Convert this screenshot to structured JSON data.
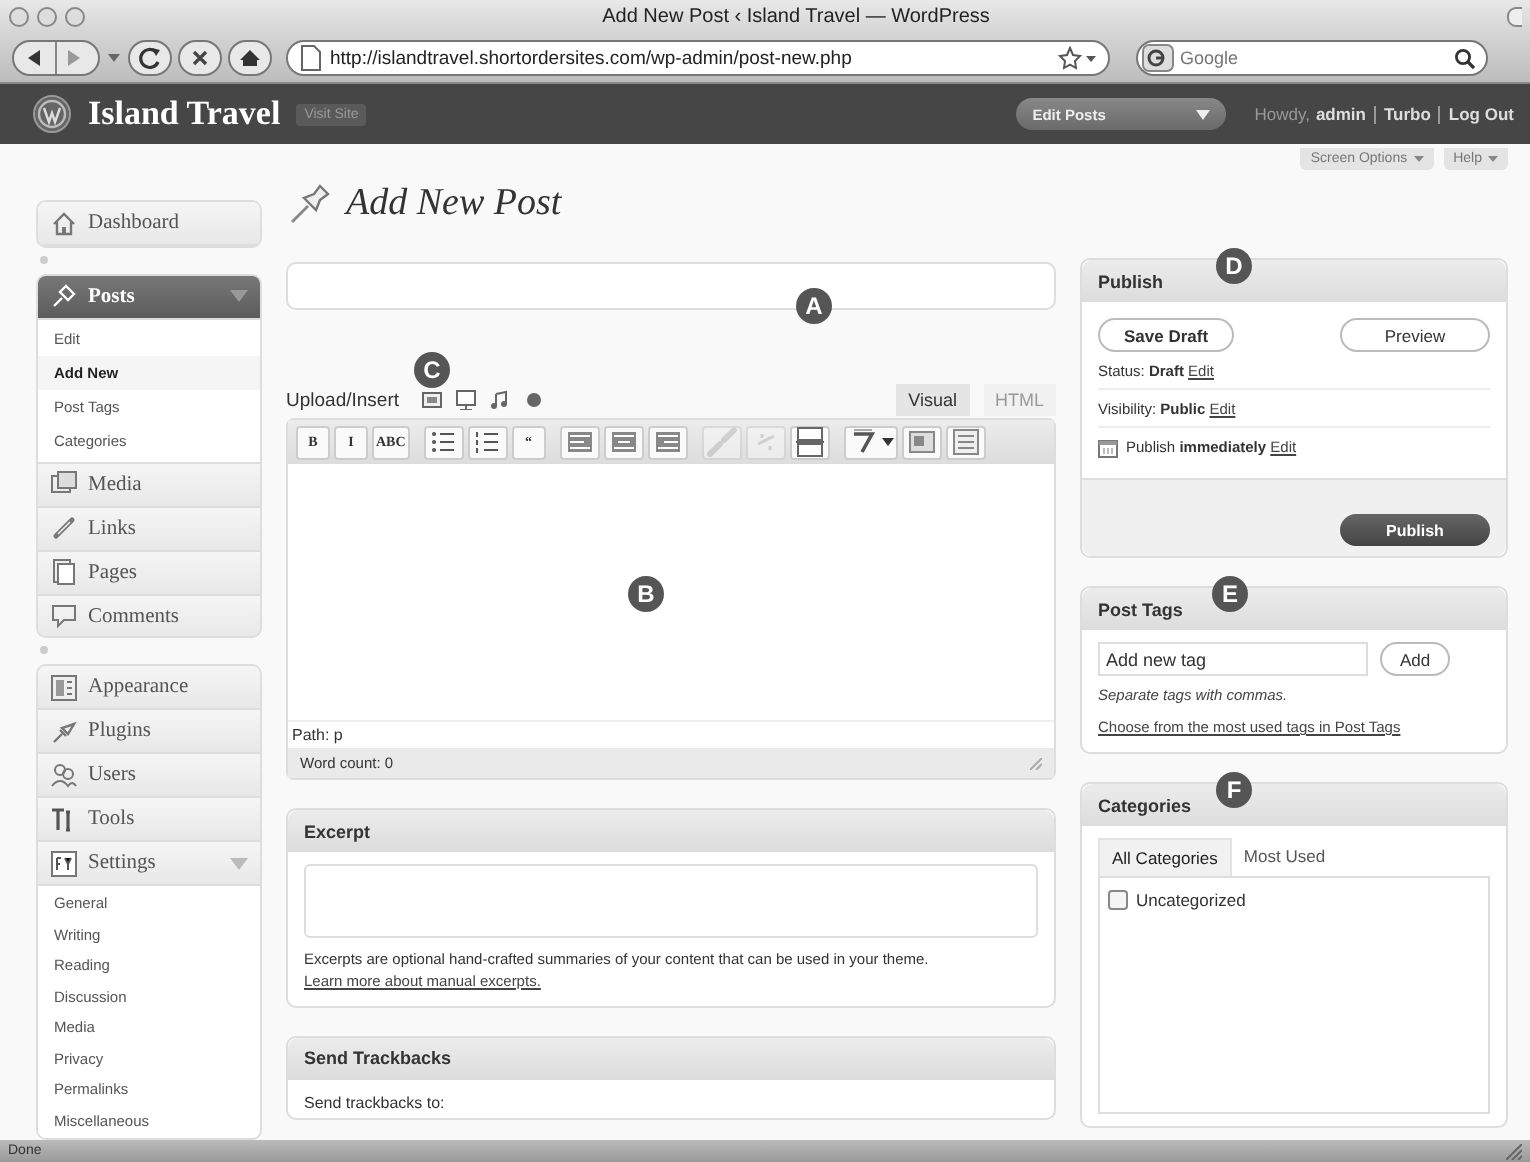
{
  "browser": {
    "title": "Add New Post ‹ Island Travel — WordPress",
    "url": "http://islandtravel.shortordersites.com/wp-admin/post-new.php",
    "search_placeholder": "Google",
    "status": "Done"
  },
  "header": {
    "site": "Island Travel",
    "visit_site": "Visit Site",
    "favorites": "Edit Posts",
    "howdy": "Howdy,",
    "user": "admin",
    "links": [
      "Turbo",
      "Log Out"
    ]
  },
  "screen_buttons": [
    "Screen Options",
    "Help"
  ],
  "menu": [
    [
      {
        "label": "Dashboard",
        "kind": "dashboard",
        "selected": false,
        "expanded": false
      }
    ],
    [
      {
        "label": "Posts",
        "kind": "posts",
        "selected": true,
        "expanded": true,
        "children": [
          {
            "label": "Edit",
            "selected": false
          },
          {
            "label": "Add New",
            "selected": true
          },
          {
            "label": "Post Tags",
            "selected": false
          },
          {
            "label": "Categories",
            "selected": false
          }
        ]
      },
      {
        "label": "Media",
        "kind": "media",
        "selected": false,
        "expanded": false
      },
      {
        "label": "Links",
        "kind": "links",
        "selected": false,
        "expanded": false
      },
      {
        "label": "Pages",
        "kind": "pages",
        "selected": false,
        "expanded": false
      },
      {
        "label": "Comments",
        "kind": "comments",
        "selected": false,
        "expanded": false
      }
    ],
    [
      {
        "label": "Appearance",
        "kind": "appearance",
        "selected": false,
        "expanded": false
      },
      {
        "label": "Plugins",
        "kind": "plugins",
        "selected": false,
        "expanded": false
      },
      {
        "label": "Users",
        "kind": "users",
        "selected": false,
        "expanded": false
      },
      {
        "label": "Tools",
        "kind": "tools",
        "selected": false,
        "expanded": false
      },
      {
        "label": "Settings",
        "kind": "settings",
        "selected": false,
        "expanded": true,
        "children": [
          {
            "label": "General",
            "selected": false
          },
          {
            "label": "Writing",
            "selected": false
          },
          {
            "label": "Reading",
            "selected": false
          },
          {
            "label": "Discussion",
            "selected": false
          },
          {
            "label": "Media",
            "selected": false
          },
          {
            "label": "Privacy",
            "selected": false
          },
          {
            "label": "Permalinks",
            "selected": false
          },
          {
            "label": "Miscellaneous",
            "selected": false
          }
        ]
      }
    ]
  ],
  "heading": "Add New Post",
  "title_field": {
    "callout": "A"
  },
  "editor": {
    "callout": "B",
    "upload_label": "Upload/Insert",
    "upload_callout": "C",
    "media": [
      {
        "kind": "image"
      },
      {
        "kind": "video"
      },
      {
        "kind": "audio"
      },
      {
        "kind": "media"
      }
    ],
    "tabs": [
      {
        "label": "Visual",
        "selected": true
      },
      {
        "label": "HTML",
        "selected": false
      }
    ],
    "toolbar": [
      {
        "kind": "text",
        "label": "B",
        "disabled": false
      },
      {
        "kind": "text",
        "label": "I",
        "disabled": false
      },
      {
        "kind": "text",
        "label": "ABC",
        "disabled": false
      },
      {
        "kind": "bullets",
        "disabled": false
      },
      {
        "kind": "numbers",
        "disabled": false
      },
      {
        "kind": "text",
        "label": "“",
        "disabled": false
      },
      {
        "kind": "align-left",
        "disabled": false
      },
      {
        "kind": "align-center",
        "disabled": false
      },
      {
        "kind": "align-right",
        "disabled": false
      },
      {
        "kind": "link",
        "disabled": true
      },
      {
        "kind": "unlink",
        "disabled": true
      },
      {
        "kind": "more",
        "disabled": false
      },
      {
        "kind": "spell",
        "disabled": false
      },
      {
        "kind": "fullscreen",
        "disabled": false
      },
      {
        "kind": "kitchen",
        "disabled": false
      }
    ],
    "path": "Path: p",
    "word_count": "Word count: 0"
  },
  "excerpt": {
    "title": "Excerpt",
    "note": "Excerpts are optional hand-crafted summaries of your content that can be used in your theme. ",
    "link": "Learn more about manual excerpts."
  },
  "trackbacks": {
    "title": "Send Trackbacks",
    "label": "Send trackbacks to:"
  },
  "publish": {
    "title": "Publish",
    "callout": "D",
    "save": "Save Draft",
    "preview": "Preview",
    "rows": [
      {
        "kind": "status",
        "label": "Status: ",
        "value": "Draft",
        "link": "Edit"
      },
      {
        "kind": "visibility",
        "label": "Visibility: ",
        "value": "Public",
        "link": "Edit"
      },
      {
        "kind": "schedule",
        "label": "Publish ",
        "value": "immediately",
        "link": "Edit"
      }
    ],
    "button": "Publish"
  },
  "tags": {
    "title": "Post Tags",
    "callout": "E",
    "placeholder": "Add new tag",
    "add": "Add",
    "hint": "Separate tags with commas.",
    "link": "Choose from the most used tags in Post Tags"
  },
  "categories": {
    "title": "Categories",
    "callout": "F",
    "tabs": [
      {
        "label": "All Categories",
        "selected": true
      },
      {
        "label": "Most Used",
        "selected": false
      }
    ],
    "items": [
      {
        "label": "Uncategorized",
        "checked": false
      }
    ]
  }
}
